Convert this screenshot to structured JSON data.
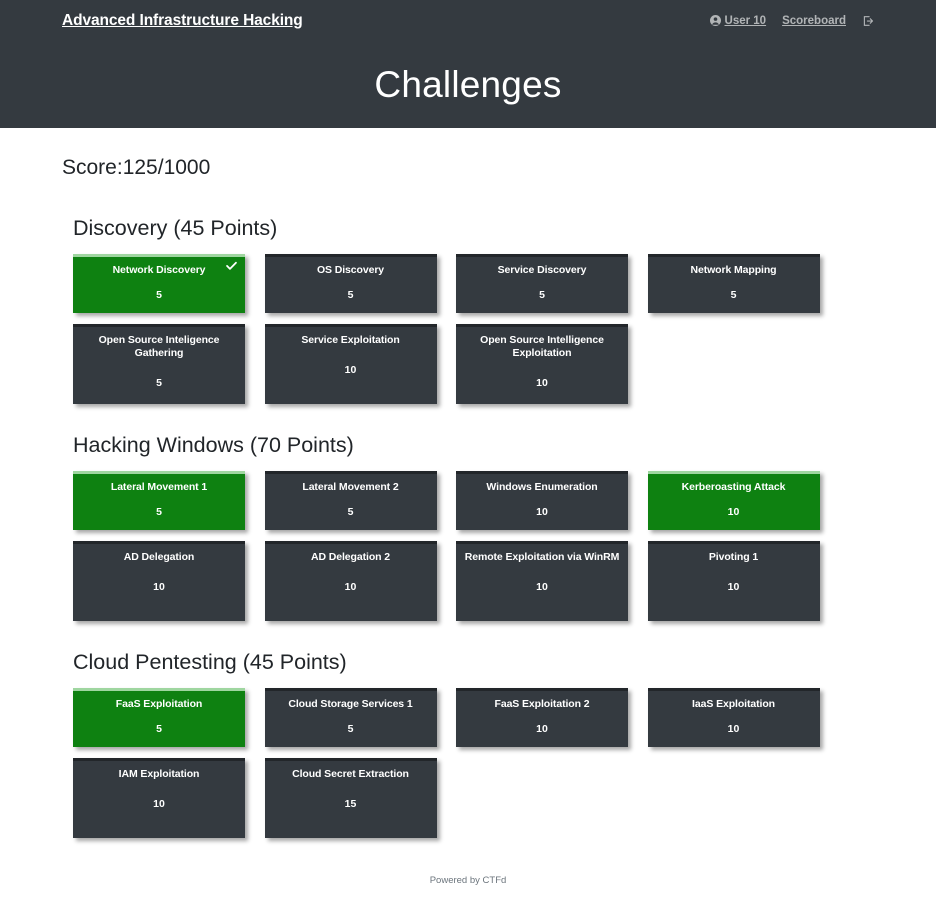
{
  "navbar": {
    "brand": "Advanced Infrastructure Hacking",
    "user_label": "User 10",
    "scoreboard_label": "Scoreboard",
    "user_icon": "user-circle-icon",
    "logout_icon": "sign-out-icon"
  },
  "hero": {
    "title": "Challenges"
  },
  "score": {
    "text": "Score:125/1000",
    "current": 125,
    "max": 1000
  },
  "colors": {
    "navbar_bg": "#343a40",
    "card_bg": "#343a40",
    "solved_bg": "#0e8111",
    "solved_accent": "#9fd6a0",
    "page_bg": "#ffffff",
    "muted_text": "#6c757d"
  },
  "categories": [
    {
      "id": "discovery",
      "title": "Discovery (45 Points)",
      "name": "Discovery",
      "points": 45,
      "challenges": [
        {
          "name": "Network Discovery",
          "value": "5",
          "solved": true,
          "lines": 1,
          "clipped": false
        },
        {
          "name": "OS Discovery",
          "value": "5",
          "solved": false,
          "lines": 1,
          "clipped": false
        },
        {
          "name": "Service Discovery",
          "value": "5",
          "solved": false,
          "lines": 1,
          "clipped": false
        },
        {
          "name": "Network Mapping",
          "value": "5",
          "solved": false,
          "lines": 1,
          "clipped": false
        },
        {
          "name": "Open Source Inteligence Gathering",
          "value": "5",
          "solved": false,
          "lines": 2,
          "clipped": false
        },
        {
          "name": "Service Exploitation",
          "value": "10",
          "solved": false,
          "lines": 1,
          "clipped": false
        },
        {
          "name": "Open Source Intelligence Exploitation",
          "value": "10",
          "solved": false,
          "lines": 2,
          "clipped": false
        }
      ]
    },
    {
      "id": "hacking-windows",
      "title": "Hacking Windows (70 Points)",
      "name": "Hacking Windows",
      "points": 70,
      "challenges": [
        {
          "name": "Lateral Movement 1",
          "value": "5",
          "solved": true,
          "lines": 1,
          "clipped": false
        },
        {
          "name": "Lateral Movement 2",
          "value": "5",
          "solved": false,
          "lines": 1,
          "clipped": false
        },
        {
          "name": "Windows Enumeration",
          "value": "10",
          "solved": false,
          "lines": 1,
          "clipped": false
        },
        {
          "name": "Kerberoasting Attack",
          "value": "10",
          "solved": true,
          "lines": 1,
          "clipped": false
        },
        {
          "name": "AD Delegation",
          "value": "10",
          "solved": false,
          "lines": 1,
          "clipped": false
        },
        {
          "name": "AD Delegation 2",
          "value": "10",
          "solved": false,
          "lines": 1,
          "clipped": false
        },
        {
          "name": "Remote Exploitation via WinRM",
          "value": "10",
          "solved": false,
          "lines": 1,
          "clipped": true
        },
        {
          "name": "Pivoting 1",
          "value": "10",
          "solved": false,
          "lines": 1,
          "clipped": false
        }
      ]
    },
    {
      "id": "cloud-pentesting",
      "title": "Cloud Pentesting (45 Points)",
      "name": "Cloud Pentesting",
      "points": 45,
      "challenges": [
        {
          "name": "FaaS Exploitation",
          "value": "5",
          "solved": true,
          "lines": 1,
          "clipped": false
        },
        {
          "name": "Cloud Storage Services 1",
          "value": "5",
          "solved": false,
          "lines": 1,
          "clipped": false
        },
        {
          "name": "FaaS Exploitation 2",
          "value": "10",
          "solved": false,
          "lines": 1,
          "clipped": false
        },
        {
          "name": "IaaS Exploitation",
          "value": "10",
          "solved": false,
          "lines": 1,
          "clipped": false
        },
        {
          "name": "IAM Exploitation",
          "value": "10",
          "solved": false,
          "lines": 1,
          "clipped": false
        },
        {
          "name": "Cloud Secret Extraction",
          "value": "15",
          "solved": false,
          "lines": 1,
          "clipped": false
        }
      ]
    }
  ],
  "footer": {
    "text": "Powered by CTFd"
  }
}
